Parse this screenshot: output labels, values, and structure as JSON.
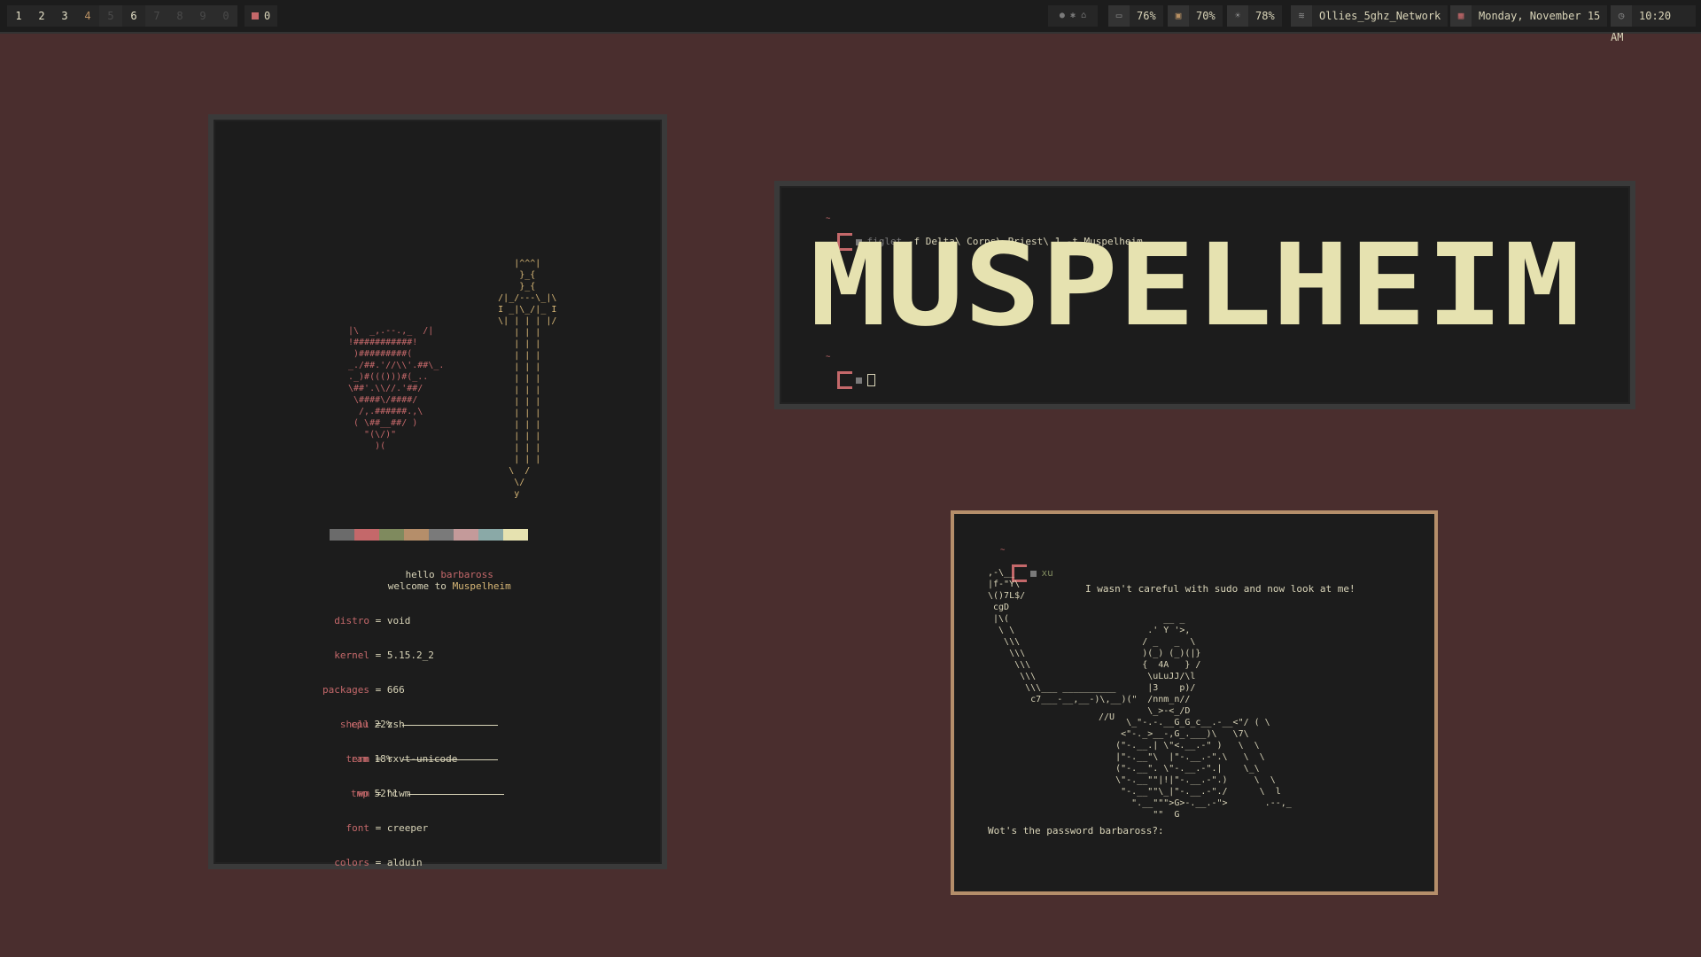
{
  "bar": {
    "tags": [
      "1",
      "2",
      "3",
      "4",
      "5",
      "6",
      "7",
      "8",
      "9",
      "0"
    ],
    "urgent_count": "0",
    "battery": "76%",
    "cpu": "70%",
    "brightness": "78%",
    "network": "Ollies_5ghz_Network",
    "date": "Monday, November 15",
    "time": "10:20 AM"
  },
  "neofetch": {
    "greeting_prefix": "hello",
    "user": "barbaross",
    "welcome_prefix": "welcome to",
    "host": "Muspelheim",
    "fields": [
      {
        "label": "distro",
        "value": "void"
      },
      {
        "label": "kernel",
        "value": "5.15.2_2"
      },
      {
        "label": "packages",
        "value": "666"
      },
      {
        "label": "shell",
        "value": "zsh"
      },
      {
        "label": "term",
        "value": "rxvt-unicode"
      },
      {
        "label": "wm",
        "value": "hlwm"
      },
      {
        "label": "font",
        "value": "creeper"
      },
      {
        "label": "colors",
        "value": "alduin"
      }
    ],
    "bars": [
      {
        "label": "cpu",
        "value": "22%"
      },
      {
        "label": "ram",
        "value": "18%"
      },
      {
        "label": "tmp",
        "value": "52°c"
      }
    ],
    "palette": [
      "#6b6b6b",
      "#c4686a",
      "#7f8a5e",
      "#b58e6a",
      "#7a7a7a",
      "#c49a9a",
      "#8aa9a7",
      "#e6e2b0"
    ],
    "sword_art": "           |^^^|\n            }_{\n            }_{\n        /|_/---\\_|\\\n        I _|\\_/|_ I\n        \\| | | | |/\n           | | |\n           | | |\n           | | |\n           | | |\n           | | |\n           | | |\n           | | |\n           | | |\n           | | |\n           | | |\n           | | |\n           | | |\n          \\  /\n           \\/\n           y",
    "fox_art": "|\\  _,.--.,_  /|\n!###########!\n )#########(\n_./##.'//\\\\'.##\\_.\n._)#((()))#(_..\n\\##'.\\\\//.'##/\n \\####\\/####/\n  /,.######.,\\\n ( \\##__##/ )\n   \"(\\/)\"\n     )("
  },
  "figlet": {
    "dir": "~",
    "command": "figlet",
    "args": "-f Delta\\ Corps\\ Priest\\ 1 -t Muspelheim",
    "banner": "MUSPELHEIM"
  },
  "sudo": {
    "dir": "~",
    "command": "xu",
    "message": "I wasn't careful with sudo and now look at me!",
    "question": "Wot's the password barbaross?:",
    "art_left": ",-\\__\n|f-\"Y\\\n\\()7L$/\n cgD\n |\\(\n  \\ \\\n   \\\\\\\n    \\\\\\\n     \\\\\\\n      \\\\\\\n       \\\\\\___ __________\n        c7___-__,__-)\\,__)(\"",
    "art_right": "              __ _\n           .' Y '>,\n          / _   _  \\\n          )(_) (_)(|}\n          {  4A   } /\n           \\uLuJJ/\\l\n           |3    p)/\n           /nnm_n//\n           \\_>-<_/D\n       \\_\"-.-.__G_G_c__.-__<\"/ ( \\\n      <\"-._>__-,G_.___)\\   \\7\\\n     (\"-.__.| \\\"<.__.-\" )   \\  \\\n     |\"-.__\"\\  |\"-.__.-\".\\   \\  \\\n     (\"-.__\". \\\"-.__.-\".|    \\_\\\n     \\\"-.__\"\"|!|\"-.__.-\".)     \\  \\\n      \"-.__\"\"\\_|\"-.__.-\"./      \\  l\n        \".__\"\"\">G>-.__.-\">       .--,_\n            \"\"  G",
    "art_slash": "//U"
  }
}
